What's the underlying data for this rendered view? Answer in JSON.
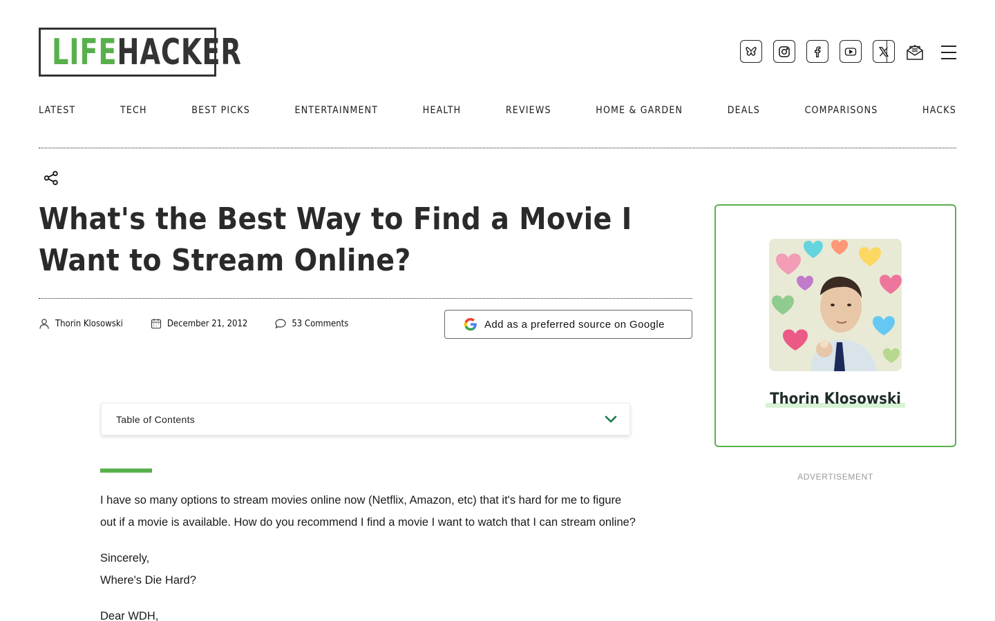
{
  "brand": {
    "logo_part1": "LIFE",
    "logo_part2": "HACKER",
    "accent_color": "#58b04c"
  },
  "header": {
    "social_icons": [
      "bluesky-icon",
      "instagram-icon",
      "facebook-icon",
      "youtube-icon",
      "x-icon"
    ],
    "newsletter_icon": "mail-icon",
    "menu_icon": "hamburger-menu-icon"
  },
  "nav": {
    "items": [
      "LATEST",
      "TECH",
      "BEST PICKS",
      "ENTERTAINMENT",
      "HEALTH",
      "REVIEWS",
      "HOME & GARDEN",
      "DEALS",
      "COMPARISONS",
      "HACKS"
    ]
  },
  "article": {
    "title": "What's the Best Way to Find a Movie I Want to Stream Online?",
    "author": "Thorin Klosowski",
    "date": "December 21, 2012",
    "comments": "53 Comments",
    "google_button": "Add as a preferred source on Google",
    "toc_label": "Table of Contents",
    "paragraphs": [
      "I have so many options to stream movies online now (Netflix, Amazon, etc) that it's hard for me to figure out if a movie is available. How do you recommend I find a movie I want to watch that I can stream online?",
      "Sincerely,\nWhere's Die Hard?",
      "Dear WDH,"
    ]
  },
  "sidebar": {
    "author_name": "Thorin Klosowski",
    "ad_label": "ADVERTISEMENT"
  }
}
